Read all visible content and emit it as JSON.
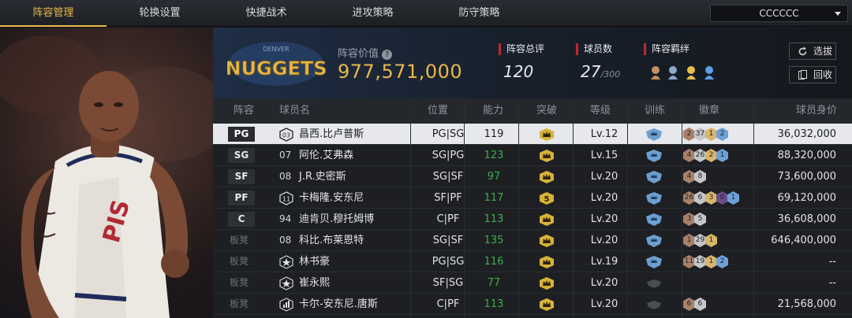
{
  "tabs": [
    {
      "label": "阵容管理",
      "active": true
    },
    {
      "label": "轮换设置",
      "active": false
    },
    {
      "label": "快捷战术",
      "active": false
    },
    {
      "label": "进攻策略",
      "active": false
    },
    {
      "label": "防守策略",
      "active": false
    }
  ],
  "team_select": {
    "value": "CCCCCC"
  },
  "header": {
    "logo_text": "NUGGETS",
    "logo_top_text": "DENVER",
    "value_label": "阵容价值",
    "value": "977,571,000",
    "rating_label": "阵容总评",
    "rating": "120",
    "players_label": "球员数",
    "players_count": "27",
    "players_max": "/300",
    "bond_label": "阵容羁绊",
    "select_button": "选拔",
    "recycle_button": "回收"
  },
  "table": {
    "headers": [
      "阵容",
      "球员名",
      "位置",
      "能力",
      "突破",
      "等级",
      "训练",
      "徽章",
      "球员身价"
    ],
    "rows": [
      {
        "slot": "PG",
        "bench": false,
        "number": "03",
        "num_style": "ring",
        "name": "昌西.比卢普斯",
        "pos": "PG|SG",
        "ability": "119",
        "green": false,
        "breakthrough": "",
        "level": "Lv.12",
        "training": true,
        "badges": [
          [
            "2",
            "#a8806a"
          ],
          [
            "37",
            "#c4c6c9"
          ],
          [
            "1",
            "#d7b56a"
          ],
          [
            "2",
            "#6ea0d6"
          ]
        ],
        "value": "36,032,000",
        "selected": true
      },
      {
        "slot": "SG",
        "bench": false,
        "number": "07",
        "num_style": "plain",
        "name": "阿伦.艾弗森",
        "pos": "SG|PG",
        "ability": "123",
        "green": true,
        "breakthrough": "",
        "level": "Lv.15",
        "training": true,
        "badges": [
          [
            "4",
            "#a8806a"
          ],
          [
            "26",
            "#c4c6c9"
          ],
          [
            "2",
            "#d7b56a"
          ],
          [
            "1",
            "#6ea0d6"
          ]
        ],
        "value": "88,320,000",
        "selected": false
      },
      {
        "slot": "SF",
        "bench": false,
        "number": "08",
        "num_style": "plain",
        "name": "J.R.史密斯",
        "pos": "SG|SF",
        "ability": "97",
        "green": true,
        "breakthrough": "",
        "level": "Lv.20",
        "training": true,
        "badges": [
          [
            "4",
            "#a8806a"
          ],
          [
            "8",
            "#c4c6c9"
          ]
        ],
        "value": "73,600,000",
        "selected": false
      },
      {
        "slot": "PF",
        "bench": false,
        "number": "11",
        "num_style": "ring",
        "name": "卡梅隆.安东尼",
        "pos": "SF|PF",
        "ability": "117",
        "green": true,
        "breakthrough": "5",
        "level": "Lv.20",
        "training": true,
        "badges": [
          [
            "26",
            "#a8806a"
          ],
          [
            "6",
            "#c4c6c9"
          ],
          [
            "3",
            "#d7b56a"
          ],
          [
            "0",
            "#6a4c8a"
          ],
          [
            "1",
            "#6ea0d6"
          ]
        ],
        "value": "69,120,000",
        "selected": false
      },
      {
        "slot": "C",
        "bench": false,
        "number": "94",
        "num_style": "plain",
        "name": "迪肯贝.穆托姆博",
        "pos": "C|PF",
        "ability": "113",
        "green": true,
        "breakthrough": "",
        "level": "Lv.20",
        "training": true,
        "badges": [
          [
            "3",
            "#a8806a"
          ],
          [
            "5",
            "#c4c6c9"
          ]
        ],
        "value": "36,608,000",
        "selected": false
      },
      {
        "slot": "板凳",
        "bench": true,
        "number": "08",
        "num_style": "plain",
        "name": "科比.布莱恩特",
        "pos": "SG|SF",
        "ability": "135",
        "green": true,
        "breakthrough": "",
        "level": "Lv.20",
        "training": true,
        "badges": [
          [
            "1",
            "#a8806a"
          ],
          [
            "29",
            "#c4c6c9"
          ],
          [
            "1",
            "#d7b56a"
          ]
        ],
        "value": "646,400,000",
        "selected": false
      },
      {
        "slot": "板凳",
        "bench": true,
        "number": "",
        "num_style": "star",
        "name": "林书豪",
        "pos": "PG|SG",
        "ability": "116",
        "green": true,
        "breakthrough": "",
        "level": "Lv.19",
        "training": true,
        "badges": [
          [
            "11",
            "#a8806a"
          ],
          [
            "19",
            "#c4c6c9"
          ],
          [
            "1",
            "#d7b56a"
          ],
          [
            "2",
            "#6ea0d6"
          ]
        ],
        "value": "--",
        "selected": false
      },
      {
        "slot": "板凳",
        "bench": true,
        "number": "",
        "num_style": "star",
        "name": "崔永熙",
        "pos": "SF|SG",
        "ability": "77",
        "green": true,
        "breakthrough": "",
        "level": "Lv.20",
        "training": false,
        "badges": [],
        "value": "--",
        "selected": false
      },
      {
        "slot": "板凳",
        "bench": true,
        "number": "",
        "num_style": "bars",
        "name": "卡尔-安东尼.唐斯",
        "pos": "C|PF",
        "ability": "113",
        "green": true,
        "breakthrough": "",
        "level": "Lv.20",
        "training": false,
        "badges": [
          [
            "6",
            "#a8806a"
          ],
          [
            "6",
            "#c4c6c9"
          ]
        ],
        "value": "21,568,000",
        "selected": false
      }
    ]
  },
  "colors": {
    "accent": "#e9b84a",
    "green": "#3fae4a",
    "red_marker": "#c0282e"
  }
}
